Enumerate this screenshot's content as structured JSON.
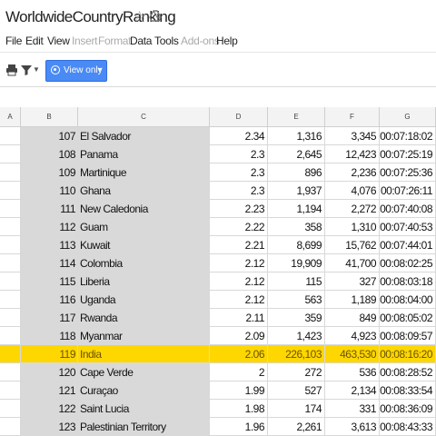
{
  "title": "WorldwideCountryRanking",
  "menu": [
    {
      "label": "File",
      "enabled": true
    },
    {
      "label": "Edit",
      "enabled": true
    },
    {
      "label": "View",
      "enabled": true
    },
    {
      "label": "Insert",
      "enabled": false
    },
    {
      "label": "Format",
      "enabled": false
    },
    {
      "label": "Data",
      "enabled": true
    },
    {
      "label": "Tools",
      "enabled": true
    },
    {
      "label": "Add-ons",
      "enabled": false
    },
    {
      "label": "Help",
      "enabled": true
    }
  ],
  "toolbar": {
    "view_only_label": "View only"
  },
  "columns": [
    "A",
    "B",
    "C",
    "D",
    "E",
    "F",
    "G"
  ],
  "highlight_color": "#ffd700",
  "rows": [
    {
      "rank": "107",
      "country": "El Salvador",
      "d": "2.34",
      "e": "1,316",
      "f": "3,345",
      "g": "00:07:18:02"
    },
    {
      "rank": "108",
      "country": "Panama",
      "d": "2.3",
      "e": "2,645",
      "f": "12,423",
      "g": "00:07:25:19"
    },
    {
      "rank": "109",
      "country": "Martinique",
      "d": "2.3",
      "e": "896",
      "f": "2,236",
      "g": "00:07:25:36"
    },
    {
      "rank": "110",
      "country": "Ghana",
      "d": "2.3",
      "e": "1,937",
      "f": "4,076",
      "g": "00:07:26:11"
    },
    {
      "rank": "111",
      "country": "New Caledonia",
      "d": "2.23",
      "e": "1,194",
      "f": "2,272",
      "g": "00:07:40:08"
    },
    {
      "rank": "112",
      "country": "Guam",
      "d": "2.22",
      "e": "358",
      "f": "1,310",
      "g": "00:07:40:53"
    },
    {
      "rank": "113",
      "country": "Kuwait",
      "d": "2.21",
      "e": "8,699",
      "f": "15,762",
      "g": "00:07:44:01"
    },
    {
      "rank": "114",
      "country": "Colombia",
      "d": "2.12",
      "e": "19,909",
      "f": "41,700",
      "g": "00:08:02:25"
    },
    {
      "rank": "115",
      "country": "Liberia",
      "d": "2.12",
      "e": "115",
      "f": "327",
      "g": "00:08:03:18"
    },
    {
      "rank": "116",
      "country": "Uganda",
      "d": "2.12",
      "e": "563",
      "f": "1,189",
      "g": "00:08:04:00"
    },
    {
      "rank": "117",
      "country": "Rwanda",
      "d": "2.11",
      "e": "359",
      "f": "849",
      "g": "00:08:05:02"
    },
    {
      "rank": "118",
      "country": "Myanmar",
      "d": "2.09",
      "e": "1,423",
      "f": "4,923",
      "g": "00:08:09:57"
    },
    {
      "rank": "119",
      "country": "India",
      "d": "2.06",
      "e": "226,103",
      "f": "463,530",
      "g": "00:08:16:20",
      "highlight": true
    },
    {
      "rank": "120",
      "country": "Cape Verde",
      "d": "2",
      "e": "272",
      "f": "536",
      "g": "00:08:28:52"
    },
    {
      "rank": "121",
      "country": "Curaçao",
      "d": "1.99",
      "e": "527",
      "f": "2,134",
      "g": "00:08:33:54"
    },
    {
      "rank": "122",
      "country": "Saint Lucia",
      "d": "1.98",
      "e": "174",
      "f": "331",
      "g": "00:08:36:09"
    },
    {
      "rank": "123",
      "country": "Palestinian Territory",
      "d": "1.96",
      "e": "2,261",
      "f": "3,613",
      "g": "00:08:43:33"
    }
  ]
}
